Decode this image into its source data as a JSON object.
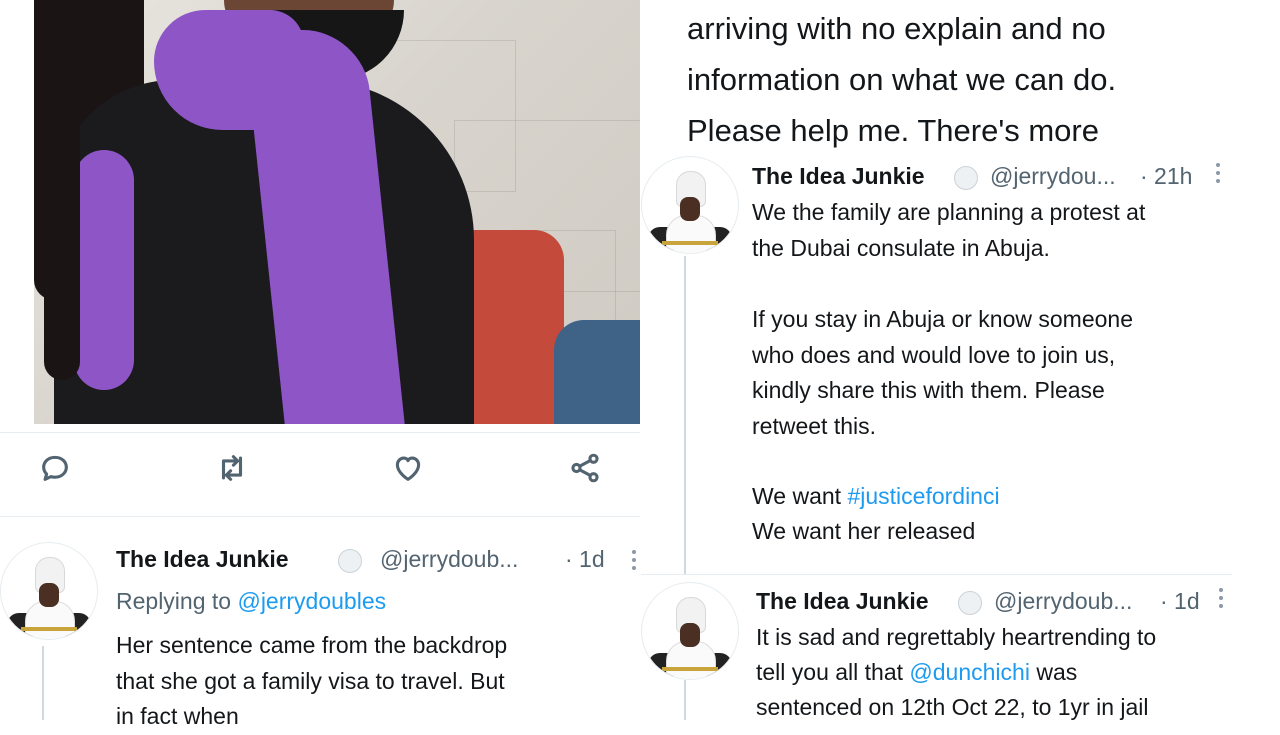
{
  "top_text": "arriving with no explain and no\ninformation on what we can do.\nPlease help me. There's more",
  "actions": {
    "reply": "reply-icon",
    "retweet": "retweet-icon",
    "like": "heart-icon",
    "share": "share-icon"
  },
  "tweets": {
    "left": {
      "name": "The Idea Junkie",
      "handle": "@jerrydoub...",
      "time": "· 1d",
      "reply_prefix": "Replying to ",
      "reply_handle": "@jerrydoubles",
      "text": "Her sentence came from the backdrop\nthat she got a family visa to travel. But\nin fact when"
    },
    "right_top": {
      "name": "The Idea Junkie",
      "handle": "@jerrydou...",
      "time": "· 21h",
      "text_1": "We the family are planning a protest at\nthe Dubai consulate in Abuja.",
      "text_2": "If you stay in Abuja or know someone\nwho does and would love to join us,\nkindly share this with them. Please\nretweet this.",
      "want_prefix": "We want ",
      "hashtag": "#justicefordinci",
      "want_2": "We want her released"
    },
    "right_bottom": {
      "name": "The Idea Junkie",
      "handle": "@jerrydoub...",
      "time": "· 1d",
      "line_1": "It is sad and regrettably heartrending to",
      "line_2_prefix": "tell you all that ",
      "mention": "@dunchichi",
      "line_2_suffix": " was",
      "line_3": "sentenced on 12th Oct 22, to 1yr in jail"
    }
  },
  "colors": {
    "link": "#1d9bf0",
    "muted": "#536471",
    "scarf": "#8e55c7"
  }
}
